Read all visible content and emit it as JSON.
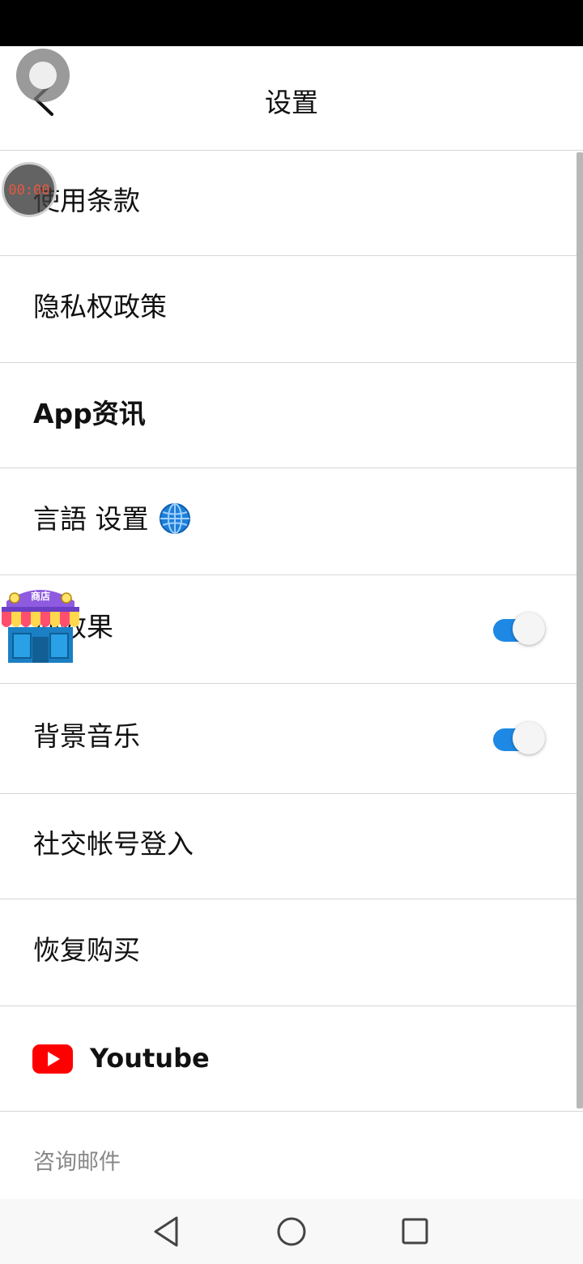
{
  "header": {
    "title": "设置"
  },
  "rows": [
    {
      "label": "使用条款"
    },
    {
      "label": "隐私权政策"
    },
    {
      "label": "App资讯"
    },
    {
      "label": "言語 设置",
      "icon": "globe-icon"
    },
    {
      "label": "动效果",
      "toggle": true
    },
    {
      "label": "背景音乐",
      "toggle": true
    },
    {
      "label": "社交帐号登入"
    },
    {
      "label": "恢复购买"
    },
    {
      "label": "Youtube",
      "icon": "youtube-icon"
    }
  ],
  "inquiry_label": "咨询邮件",
  "overlays": {
    "record_time": "00:00",
    "shop_label": "商店"
  },
  "colors": {
    "toggle_on": "#1e88e5",
    "youtube": "#ff0000",
    "divider": "#d6d6d6",
    "muted_text": "#888888"
  }
}
